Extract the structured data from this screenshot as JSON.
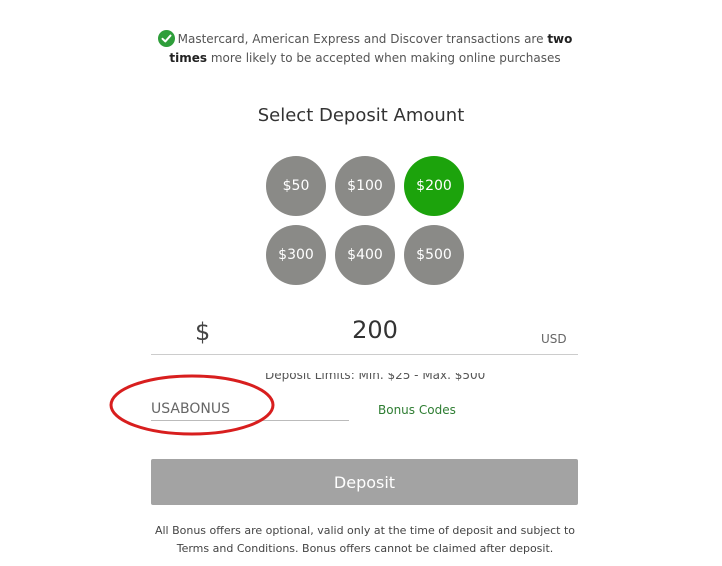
{
  "notice": {
    "icon": "check-circle-icon",
    "text_before": "Mastercard, American Express and Discover transactions are ",
    "bold1": "two",
    "bold2": "times",
    "text_after": " more likely to be accepted when making online purchases"
  },
  "title": "Select Deposit Amount",
  "amounts": [
    {
      "label": "$50",
      "selected": false
    },
    {
      "label": "$100",
      "selected": false
    },
    {
      "label": "$200",
      "selected": true
    },
    {
      "label": "$300",
      "selected": false
    },
    {
      "label": "$400",
      "selected": false
    },
    {
      "label": "$500",
      "selected": false
    }
  ],
  "amount_input": {
    "currency_symbol": "$",
    "value": "200",
    "unit": "USD"
  },
  "limits": "Deposit Limits: Min. $25 - Max. $500",
  "bonus": {
    "value": "USABONUS",
    "link": "Bonus Codes"
  },
  "deposit_button": "Deposit",
  "disclaimer": {
    "line1": "All Bonus offers are optional, valid only at the time of deposit and subject to",
    "line2": "Terms and Conditions. Bonus offers cannot be claimed after deposit."
  },
  "colors": {
    "selected": "#1ca30c",
    "unselected": "#8a8a87",
    "annotation": "#d81e1e",
    "link": "#2e7d32"
  }
}
